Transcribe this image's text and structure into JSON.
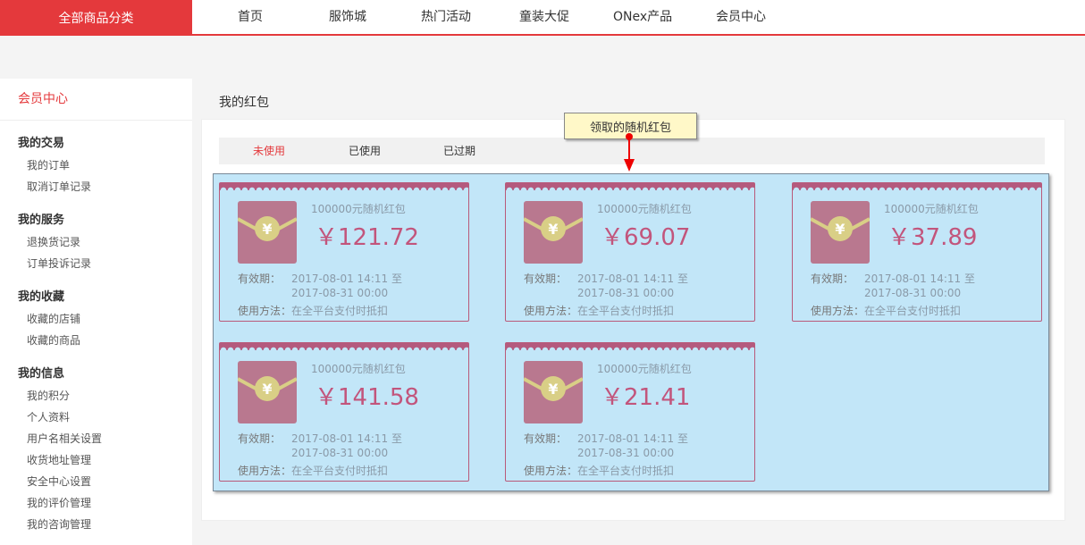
{
  "nav": {
    "all_categories": "全部商品分类",
    "items": [
      "首页",
      "服饰城",
      "热门活动",
      "童装大促",
      "ONex产品",
      "会员中心"
    ]
  },
  "sidebar": {
    "title": "会员中心",
    "groups": [
      {
        "title": "我的交易",
        "links": [
          "我的订单",
          "取消订单记录"
        ]
      },
      {
        "title": "我的服务",
        "links": [
          "退换货记录",
          "订单投诉记录"
        ]
      },
      {
        "title": "我的收藏",
        "links": [
          "收藏的店铺",
          "收藏的商品"
        ]
      },
      {
        "title": "我的信息",
        "links": [
          "我的积分",
          "个人资料",
          "用户名相关设置",
          "收货地址管理",
          "安全中心设置",
          "我的评价管理",
          "我的咨询管理"
        ]
      }
    ]
  },
  "main": {
    "title": "我的红包",
    "tabs": [
      "未使用",
      "已使用",
      "已过期"
    ],
    "active_tab": 0
  },
  "tooltip": "领取的随机红包",
  "coupon_labels": {
    "validity": "有效期：",
    "usage": "使用方法：",
    "usage_text": "在全平台支付时抵扣"
  },
  "coupons": [
    {
      "desc": "100000元随机红包",
      "amount": "￥121.72",
      "start": "2017-08-01 14:11 至",
      "end": "2017-08-31 00:00"
    },
    {
      "desc": "100000元随机红包",
      "amount": "￥69.07",
      "start": "2017-08-01 14:11 至",
      "end": "2017-08-31 00:00"
    },
    {
      "desc": "100000元随机红包",
      "amount": "￥37.89",
      "start": "2017-08-01 14:11 至",
      "end": "2017-08-31 00:00"
    },
    {
      "desc": "100000元随机红包",
      "amount": "￥141.58",
      "start": "2017-08-01 14:11 至",
      "end": "2017-08-31 00:00"
    },
    {
      "desc": "100000元随机红包",
      "amount": "￥21.41",
      "start": "2017-08-01 14:11 至",
      "end": "2017-08-31 00:00"
    }
  ],
  "colors": {
    "brand_red": "#e4393c",
    "overlay_blue": "#c2e6f8",
    "coupon_pink": "#c2557c"
  },
  "icons": {
    "envelope": "red-envelope-icon",
    "pin": "pin-marker-icon"
  }
}
